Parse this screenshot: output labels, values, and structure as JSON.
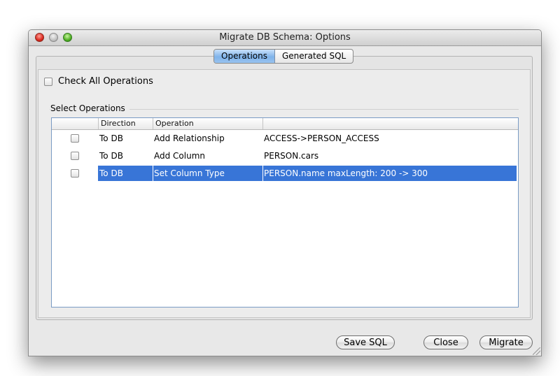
{
  "window": {
    "title": "Migrate DB Schema: Options"
  },
  "tabs": [
    {
      "label": "Operations",
      "active": true
    },
    {
      "label": "Generated SQL",
      "active": false
    }
  ],
  "options": {
    "check_all_label": "Check All Operations",
    "check_all_checked": false,
    "group_label": "Select Operations"
  },
  "table": {
    "columns": [
      "",
      "Direction",
      "Operation",
      ""
    ],
    "rows": [
      {
        "checked": false,
        "direction": "To DB",
        "operation": "Add Relationship",
        "detail": "ACCESS->PERSON_ACCESS",
        "selected": false
      },
      {
        "checked": false,
        "direction": "To DB",
        "operation": "Add Column",
        "detail": "PERSON.cars",
        "selected": false
      },
      {
        "checked": false,
        "direction": "To DB",
        "operation": "Set Column Type",
        "detail": "PERSON.name maxLength: 200 -> 300",
        "selected": true
      }
    ]
  },
  "buttons": {
    "save_sql": "Save SQL",
    "close": "Close",
    "migrate": "Migrate"
  },
  "colors": {
    "selection": "#3875d7",
    "active_tab": "#7fb3ea"
  },
  "icons": [
    "close-window-icon",
    "minimize-window-icon",
    "zoom-window-icon",
    "resize-grip-icon"
  ]
}
